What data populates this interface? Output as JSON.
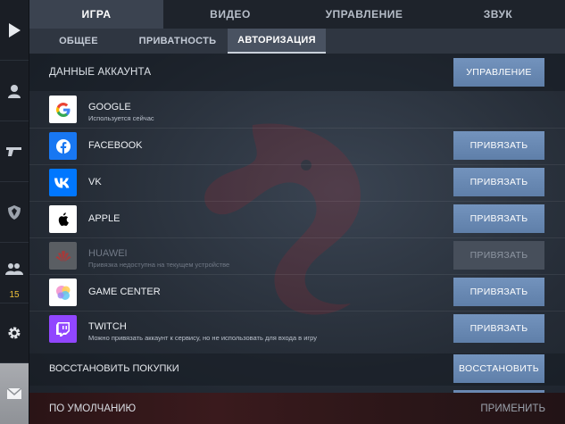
{
  "top_tabs": [
    "ИГРА",
    "ВИДЕО",
    "УПРАВЛЕНИЕ",
    "ЗВУК"
  ],
  "sub_tabs": [
    "ОБЩЕЕ",
    "ПРИВАТНОСТЬ",
    "АВТОРИЗАЦИЯ"
  ],
  "account": {
    "title": "ДАННЫЕ АККАУНТА",
    "manage_label": "УПРАВЛЕНИЕ"
  },
  "services": [
    {
      "name": "GOOGLE",
      "note": "Используется сейчас",
      "button": "",
      "icon": "google-icon",
      "color": "#ffffff",
      "enabled": true
    },
    {
      "name": "FACEBOOK",
      "note": "",
      "button": "ПРИВЯЗАТЬ",
      "icon": "facebook-icon",
      "color": "#1877f2",
      "enabled": true
    },
    {
      "name": "VK",
      "note": "",
      "button": "ПРИВЯЗАТЬ",
      "icon": "vk-icon",
      "color": "#0077ff",
      "enabled": true
    },
    {
      "name": "APPLE",
      "note": "",
      "button": "ПРИВЯЗАТЬ",
      "icon": "apple-icon",
      "color": "#ffffff",
      "enabled": true
    },
    {
      "name": "HUAWEI",
      "note": "Привязка недоступна на текущем устройстве",
      "button": "ПРИВЯЗАТЬ",
      "icon": "huawei-icon",
      "color": "#5a5e63",
      "enabled": false
    },
    {
      "name": "GAME CENTER",
      "note": "",
      "button": "ПРИВЯЗАТЬ",
      "icon": "game-center-icon",
      "color": "#ffffff",
      "enabled": true
    },
    {
      "name": "TWITCH",
      "note": "Можно привязать аккаунт к сервису, но не использовать для входа в игру",
      "button": "ПРИВЯЗАТЬ",
      "icon": "twitch-icon",
      "color": "#9146ff",
      "enabled": true
    }
  ],
  "restore": {
    "label": "ВОССТАНОВИТЬ ПОКУПКИ",
    "button": "ВОССТАНОВИТЬ"
  },
  "footer": {
    "defaults": "ПО УМОЛЧАНИЮ",
    "apply": "ПРИМЕНИТЬ"
  },
  "sidebar": {
    "friends_count": "15"
  },
  "colors": {
    "accent_button": "#6a8ab4",
    "footer_bg": "#2e1719"
  }
}
